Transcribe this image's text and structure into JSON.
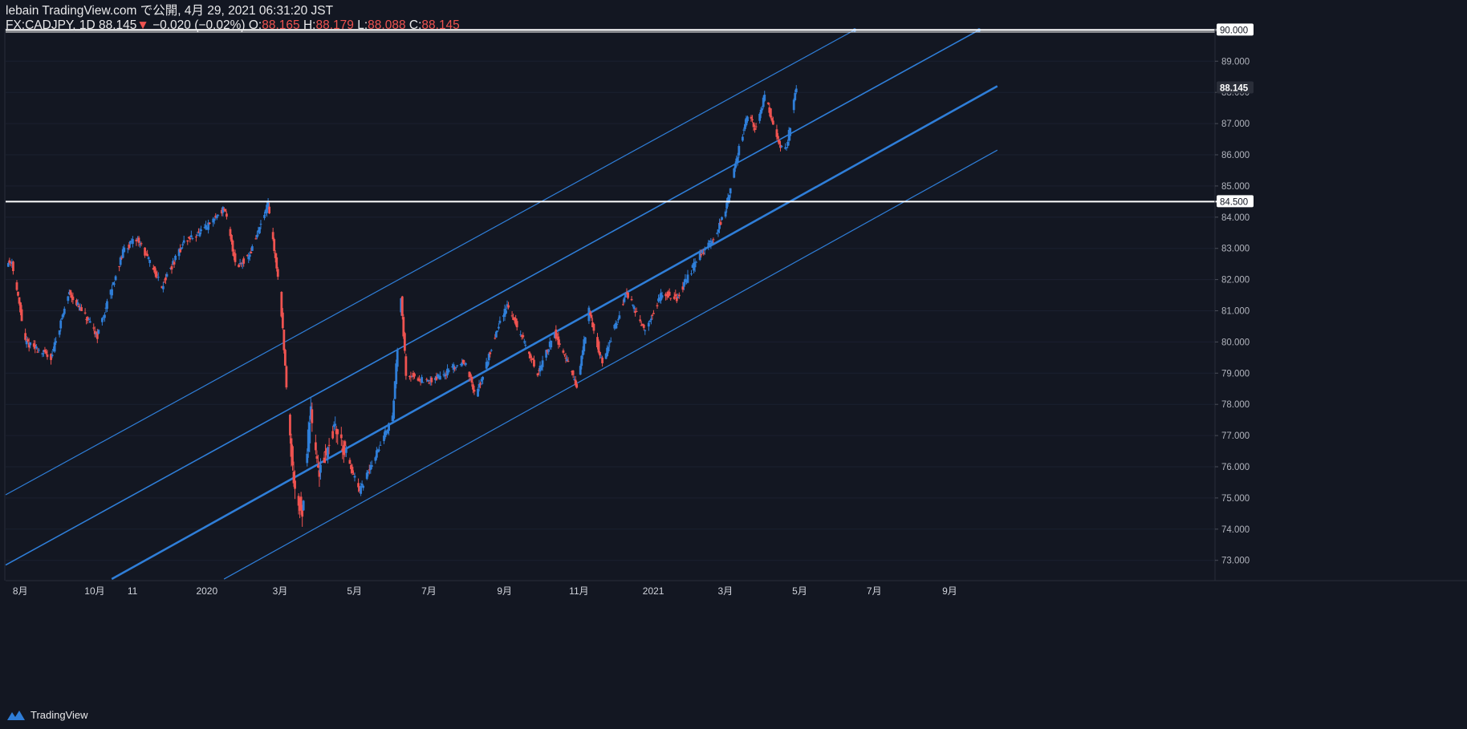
{
  "header": {
    "line1": "lebain TradingView.com で公開, 4月 29, 2021 06:31:20 JST",
    "symbol": "FX:CADJPY, 1D 88.145",
    "down_arrow": "▼",
    "change": "−0.020 (−0.02%)",
    "o_label": "O:",
    "o_value": "88.165",
    "h_label": "H:",
    "h_value": "88.179",
    "l_label": "L:",
    "l_value": "88.088",
    "c_label": "C:",
    "c_value": "88.145"
  },
  "footer": {
    "brand": "TradingView",
    "logo_icon": "tradingview-logo-icon"
  },
  "colors": {
    "background": "#131722",
    "up": "#2f7ed8",
    "down": "#ef5350",
    "channel": "#2f7ed8",
    "level": "#ffffff",
    "axis_text": "#b2b5be"
  },
  "chart_data": {
    "type": "candlestick",
    "symbol": "FX:CADJPY",
    "interval": "1D",
    "x_ticks": [
      "8月",
      "10月",
      "11",
      "2020",
      "3月",
      "5月",
      "7月",
      "9月",
      "11月",
      "2021",
      "3月",
      "5月",
      "7月",
      "9月"
    ],
    "y_ticks": [
      "73.000",
      "74.000",
      "75.000",
      "76.000",
      "77.000",
      "78.000",
      "79.000",
      "80.000",
      "81.000",
      "82.000",
      "83.000",
      "84.000",
      "85.000",
      "86.000",
      "87.000",
      "88.000",
      "89.000",
      "90.000"
    ],
    "ylim": [
      72.4,
      90.3
    ],
    "price_labels": [
      "90.000",
      "88.145",
      "84.500"
    ],
    "horizontal_levels": [
      90.0,
      84.5
    ],
    "last_price": 88.145,
    "anchors": [
      {
        "date": "2019-07-20",
        "price": 82.5
      },
      {
        "date": "2019-07-25",
        "price": 82.6
      },
      {
        "date": "2019-08-05",
        "price": 80.0
      },
      {
        "date": "2019-08-26",
        "price": 79.5
      },
      {
        "date": "2019-09-10",
        "price": 81.6
      },
      {
        "date": "2019-10-03",
        "price": 80.2
      },
      {
        "date": "2019-10-25",
        "price": 83.0
      },
      {
        "date": "2019-11-05",
        "price": 83.3
      },
      {
        "date": "2019-11-25",
        "price": 81.8
      },
      {
        "date": "2019-12-13",
        "price": 83.2
      },
      {
        "date": "2019-12-30",
        "price": 83.6
      },
      {
        "date": "2020-01-15",
        "price": 84.3
      },
      {
        "date": "2020-01-25",
        "price": 82.4
      },
      {
        "date": "2020-02-05",
        "price": 82.8
      },
      {
        "date": "2020-02-20",
        "price": 84.4
      },
      {
        "date": "2020-03-01",
        "price": 81.5
      },
      {
        "date": "2020-03-06",
        "price": 78.6
      },
      {
        "date": "2020-03-12",
        "price": 75.5
      },
      {
        "date": "2020-03-19",
        "price": 74.5
      },
      {
        "date": "2020-03-26",
        "price": 78.0
      },
      {
        "date": "2020-04-01",
        "price": 75.8
      },
      {
        "date": "2020-04-15",
        "price": 77.3
      },
      {
        "date": "2020-05-05",
        "price": 75.2
      },
      {
        "date": "2020-06-01",
        "price": 77.6
      },
      {
        "date": "2020-06-08",
        "price": 81.5
      },
      {
        "date": "2020-06-12",
        "price": 79.0
      },
      {
        "date": "2020-06-30",
        "price": 78.7
      },
      {
        "date": "2020-07-31",
        "price": 79.4
      },
      {
        "date": "2020-08-08",
        "price": 78.2
      },
      {
        "date": "2020-08-25",
        "price": 80.3
      },
      {
        "date": "2020-09-03",
        "price": 81.2
      },
      {
        "date": "2020-09-28",
        "price": 79.0
      },
      {
        "date": "2020-10-12",
        "price": 80.3
      },
      {
        "date": "2020-10-26",
        "price": 79.0
      },
      {
        "date": "2020-10-30",
        "price": 78.5
      },
      {
        "date": "2020-11-09",
        "price": 81.0
      },
      {
        "date": "2020-11-20",
        "price": 79.3
      },
      {
        "date": "2020-12-10",
        "price": 81.6
      },
      {
        "date": "2020-12-25",
        "price": 80.3
      },
      {
        "date": "2021-01-08",
        "price": 81.6
      },
      {
        "date": "2021-01-20",
        "price": 81.4
      },
      {
        "date": "2021-02-05",
        "price": 82.6
      },
      {
        "date": "2021-02-20",
        "price": 83.4
      },
      {
        "date": "2021-03-01",
        "price": 84.2
      },
      {
        "date": "2021-03-12",
        "price": 86.2
      },
      {
        "date": "2021-03-19",
        "price": 87.3
      },
      {
        "date": "2021-03-26",
        "price": 86.8
      },
      {
        "date": "2021-04-02",
        "price": 87.9
      },
      {
        "date": "2021-04-15",
        "price": 86.3
      },
      {
        "date": "2021-04-20",
        "price": 86.2
      },
      {
        "date": "2021-04-28",
        "price": 88.145
      }
    ],
    "channel_lines": [
      {
        "name": "upper",
        "start": {
          "date": "2019-07-20",
          "price": 75.1
        },
        "end": {
          "date": "2021-06-15",
          "price": 90.0
        },
        "width": 1.2
      },
      {
        "name": "middle",
        "start": {
          "date": "2019-07-20",
          "price": 72.85
        },
        "end": {
          "date": "2021-09-25",
          "price": 90.0
        },
        "width": 1.6
      },
      {
        "name": "lower-bold",
        "start": {
          "date": "2019-10-15",
          "price": 72.4
        },
        "end": {
          "date": "2021-10-10",
          "price": 88.2
        },
        "width": 2.6
      },
      {
        "name": "bottom",
        "start": {
          "date": "2020-01-15",
          "price": 72.4
        },
        "end": {
          "date": "2021-10-10",
          "price": 86.15
        },
        "width": 1.2
      }
    ]
  }
}
